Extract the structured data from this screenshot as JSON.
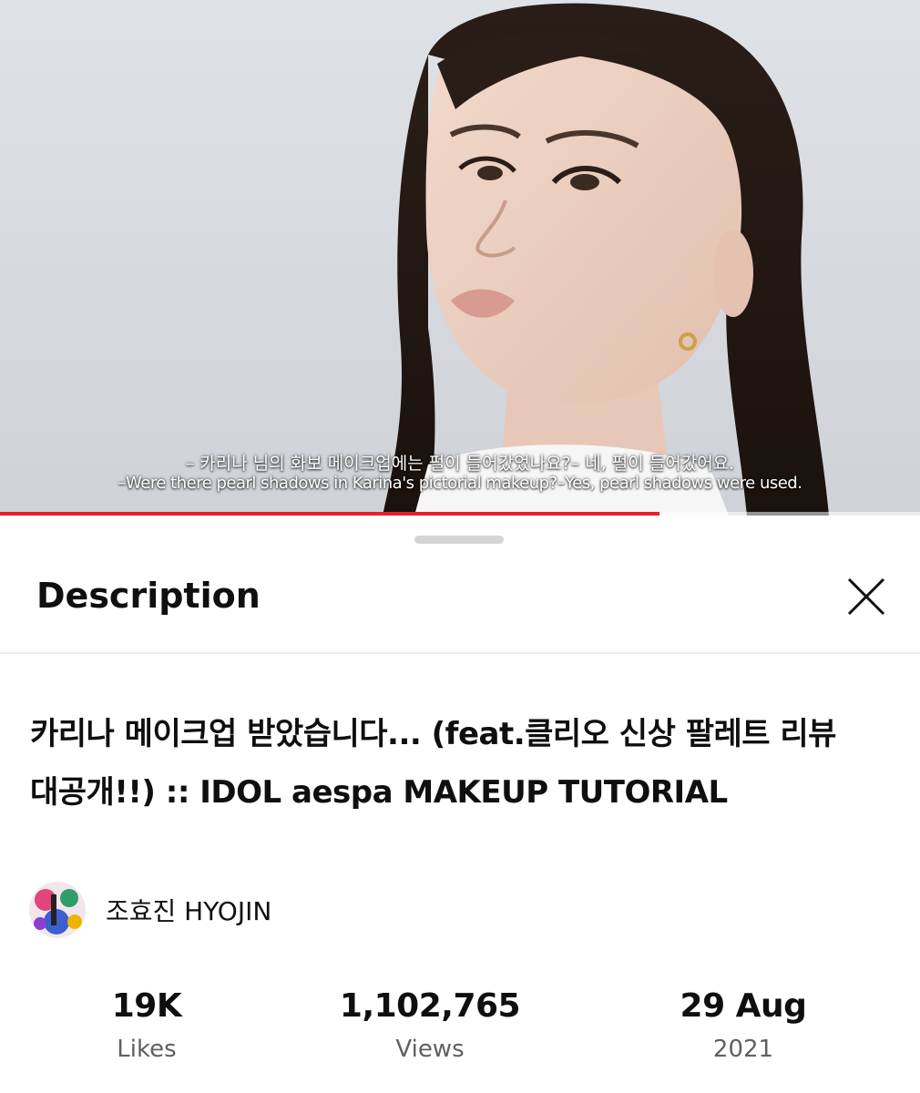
{
  "video": {
    "subtitle_korean": "– 카리나 님의 화보 메이크업에는 펄이 들어갔었나요?– 네, 펄이 들어갔어요.",
    "subtitle_english": "–Were there pearl shadows in Karina's pictorial makeup?–Yes, pearl shadows were used.",
    "progress_fraction": 0.717,
    "progress_color": "#e8202a"
  },
  "sheet": {
    "title": "Description",
    "close_icon": "close-icon",
    "video_title": "카리나 메이크업 받았습니다...  (feat.클리오 신상 팔레트 리뷰 대공개!!) :: IDOL aespa MAKEUP TUTORIAL",
    "channel_name": "조효진 HYOJIN",
    "stats": [
      {
        "value": "19K",
        "label": "Likes"
      },
      {
        "value": "1,102,765",
        "label": "Views"
      },
      {
        "value": "29 Aug",
        "label": "2021"
      }
    ]
  }
}
